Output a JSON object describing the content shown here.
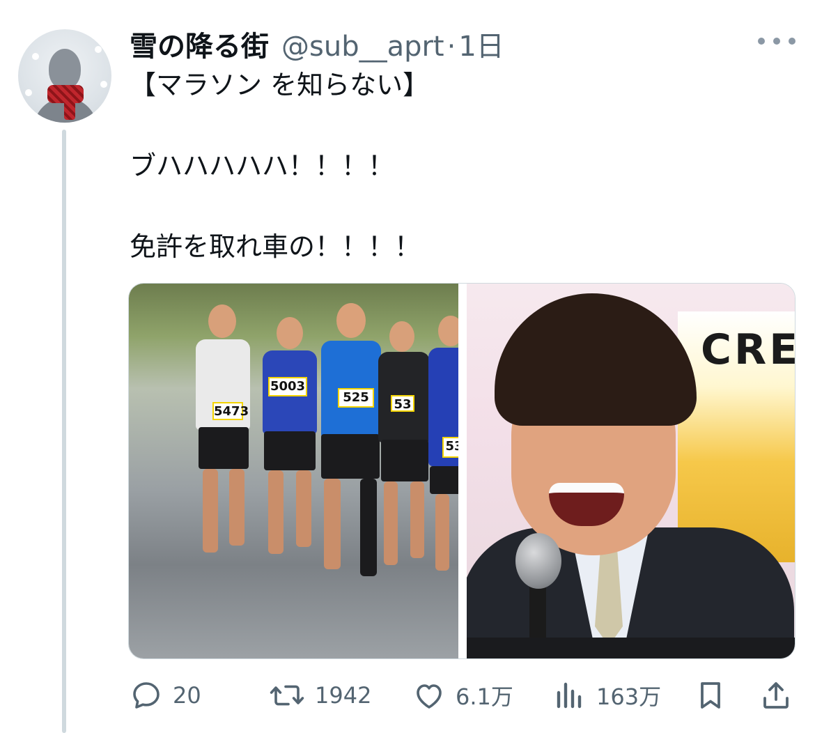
{
  "author": {
    "display_name": "雪の降る街",
    "handle": "@sub__aprt",
    "separator": "·",
    "time": "1日"
  },
  "tweet": {
    "lines": [
      "【マラソン を知らない】",
      "ブハハハハハ！！！！",
      "免許を取れ車の！！！！"
    ]
  },
  "media": {
    "left": {
      "bibs": [
        "5003",
        "525",
        "5473",
        "53",
        "53"
      ]
    },
    "right": {
      "sign_text": "CRE"
    }
  },
  "actions": {
    "reply_count": "20",
    "retweet_count": "1942",
    "like_count": "6.1万",
    "views_count": "163万"
  },
  "icons": [
    "more-icon",
    "reply-icon",
    "retweet-icon",
    "like-icon",
    "views-icon",
    "bookmark-icon",
    "share-icon"
  ],
  "colors": {
    "text": "#0f1419",
    "secondary": "#536471",
    "thread_line": "#cfd9de"
  }
}
